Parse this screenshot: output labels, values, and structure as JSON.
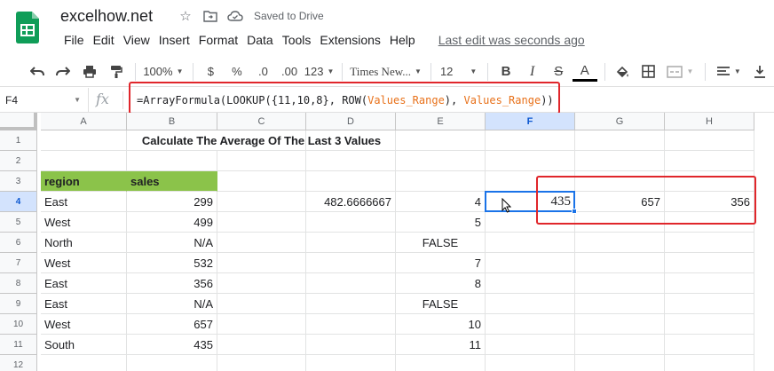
{
  "app": {
    "title": "excelhow.net",
    "saved_status": "Saved to Drive",
    "last_edit": "Last edit was seconds ago",
    "brand_color": "#0f9d58"
  },
  "menu": [
    "File",
    "Edit",
    "View",
    "Insert",
    "Format",
    "Data",
    "Tools",
    "Extensions",
    "Help"
  ],
  "toolbar": {
    "zoom": "100%",
    "currency": "$",
    "percent": "%",
    "decrease_decimal": ".0",
    "increase_decimal": ".00",
    "more_formats": "123",
    "font": "Times New...",
    "font_size": "12",
    "bold": "B",
    "italic": "I",
    "strike": "S",
    "text_color": "A"
  },
  "formula_bar": {
    "cell_ref": "F4",
    "fx": "fx",
    "formula_parts": [
      "=ArrayFormula(LOOKUP({11,10,8}, ROW(",
      "Values_Range",
      "), ",
      "Values_Range",
      "))"
    ]
  },
  "columns": [
    "A",
    "B",
    "C",
    "D",
    "E",
    "F",
    "G",
    "H"
  ],
  "rows": [
    "1",
    "2",
    "3",
    "4",
    "5",
    "6",
    "7",
    "8",
    "9",
    "10",
    "11",
    "12"
  ],
  "cells": {
    "B1": "Calculate The Average Of The Last 3 Values",
    "A3": "region",
    "B3": "sales",
    "A4": "East",
    "B4": "299",
    "D4": "482.6666667",
    "E4": "4",
    "F4": "435",
    "G4": "657",
    "H4": "356",
    "A5": "West",
    "B5": "499",
    "E5": "5",
    "A6": "North",
    "B6": "N/A",
    "E6": "FALSE",
    "A7": "West",
    "B7": "532",
    "E7": "7",
    "A8": "East",
    "B8": "356",
    "E8": "8",
    "A9": "East",
    "B9": "N/A",
    "E9": "FALSE",
    "A10": "West",
    "B10": "657",
    "E10": "10",
    "A11": "South",
    "B11": "435",
    "E11": "11"
  },
  "colors": {
    "header_fill": "#8bc34a",
    "highlight": "#e0262b",
    "selection": "#1a73e8",
    "named_range": "#e8711a"
  }
}
